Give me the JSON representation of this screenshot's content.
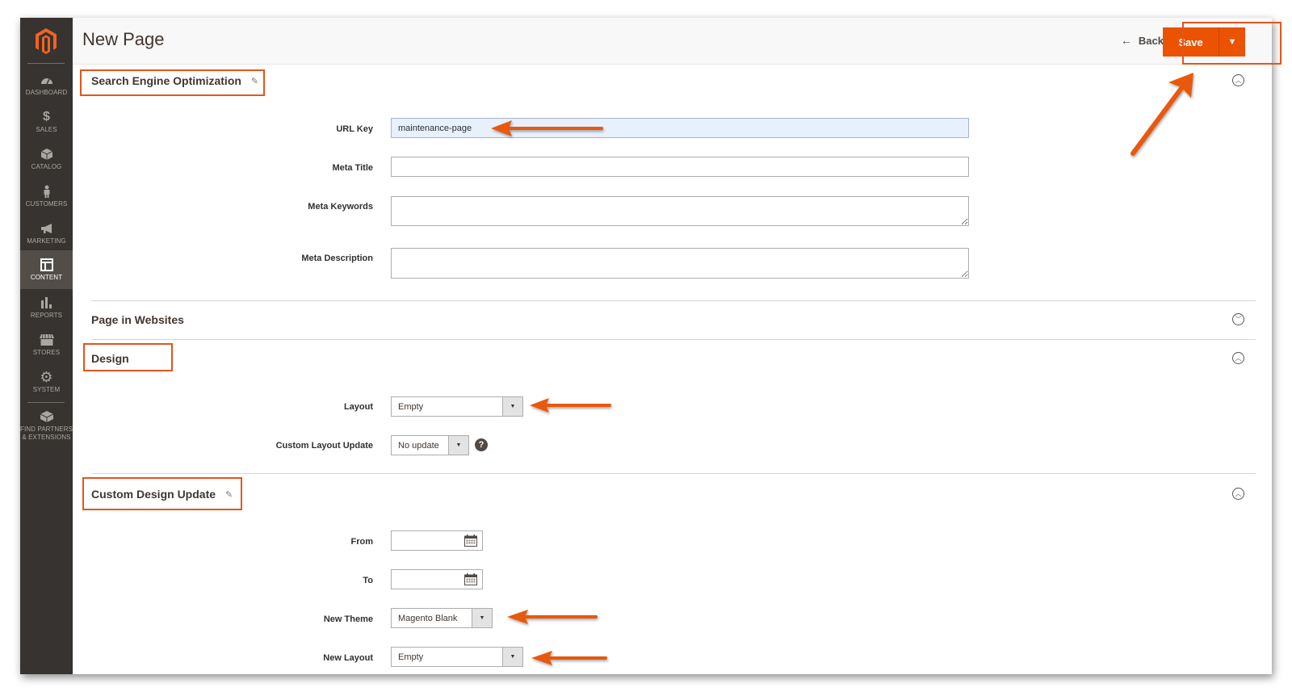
{
  "sidebar": {
    "logo": "magento-logo",
    "items": [
      {
        "label": "DASHBOARD",
        "icon": "dashboard-icon"
      },
      {
        "label": "SALES",
        "icon": "dollar-icon"
      },
      {
        "label": "CATALOG",
        "icon": "box-icon"
      },
      {
        "label": "CUSTOMERS",
        "icon": "person-icon"
      },
      {
        "label": "MARKETING",
        "icon": "megaphone-icon"
      },
      {
        "label": "CONTENT",
        "icon": "layout-icon",
        "active": true
      },
      {
        "label": "REPORTS",
        "icon": "bar-chart-icon"
      },
      {
        "label": "STORES",
        "icon": "storefront-icon"
      },
      {
        "label": "SYSTEM",
        "icon": "gear-icon"
      },
      {
        "label": "FIND PARTNERS",
        "label2": "& EXTENSIONS",
        "icon": "cubes-icon"
      }
    ]
  },
  "header": {
    "title": "New Page",
    "back_label": "Back",
    "back_icon": "←",
    "save_label": "Save",
    "save_toggle_icon": "▼"
  },
  "sections": {
    "seo": {
      "title": "Search Engine Optimization",
      "edit_icon": "✎",
      "collapse_icon": "︿",
      "fields": {
        "url_key": {
          "label": "URL Key",
          "value": "maintenance-page"
        },
        "meta_title": {
          "label": "Meta Title",
          "value": ""
        },
        "meta_keywords": {
          "label": "Meta Keywords",
          "value": ""
        },
        "meta_description": {
          "label": "Meta Description",
          "value": ""
        }
      }
    },
    "websites": {
      "title": "Page in Websites",
      "collapse_icon": "﹀"
    },
    "design": {
      "title": "Design",
      "collapse_icon": "︿",
      "fields": {
        "layout": {
          "label": "Layout",
          "value": "Empty"
        },
        "custom_layout_update": {
          "label": "Custom Layout Update",
          "value": "No update",
          "help": "?"
        }
      }
    },
    "custom_design": {
      "title": "Custom Design Update",
      "edit_icon": "✎",
      "collapse_icon": "︿",
      "fields": {
        "from": {
          "label": "From",
          "value": ""
        },
        "to": {
          "label": "To",
          "value": ""
        },
        "new_theme": {
          "label": "New Theme",
          "value": "Magento Blank"
        },
        "new_layout": {
          "label": "New Layout",
          "value": "Empty"
        }
      }
    }
  },
  "annotations": {
    "color": "#e4551d",
    "arrow_color": "#e8590c"
  }
}
